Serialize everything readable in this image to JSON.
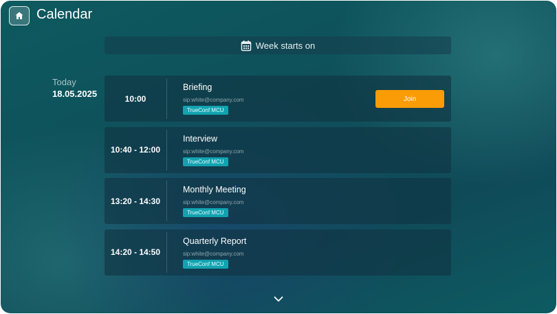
{
  "header": {
    "title": "Calendar",
    "home_icon": "home-icon"
  },
  "week_bar": {
    "icon": "calendar-icon",
    "label": "Week starts on"
  },
  "day": {
    "label": "Today",
    "date": "18.05.2025"
  },
  "events": [
    {
      "time": "10:00",
      "title": "Briefing",
      "address": "sip:white@company.com",
      "badge": "TrueConf MCU",
      "action": "Join"
    },
    {
      "time": "10:40 - 12:00",
      "title": "Interview",
      "address": "sip:white@company.com",
      "badge": "TrueConf MCU"
    },
    {
      "time": "13:20 - 14:30",
      "title": "Monthly Meeting",
      "address": "sip:white@company.com",
      "badge": "TrueConf MCU"
    },
    {
      "time": "14:20 - 14:50",
      "title": "Quarterly Report",
      "address": "sip:white@company.com",
      "badge": "TrueConf MCU"
    }
  ],
  "footer": {
    "scroll_icon": "chevron-down-icon"
  },
  "colors": {
    "accent": "#f99c06",
    "badge": "#12a3b0"
  }
}
